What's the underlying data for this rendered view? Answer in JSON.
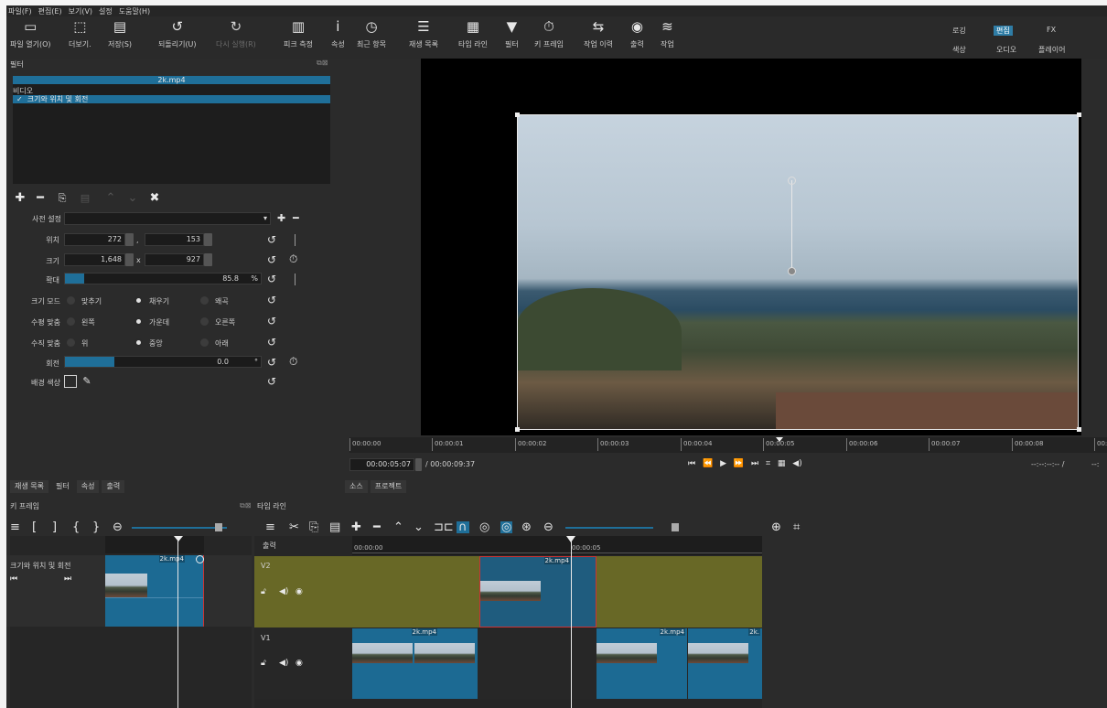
{
  "menu": [
    "파일(F)",
    "편집(E)",
    "보기(V)",
    "설정",
    "도움말(H)"
  ],
  "toolbar": {
    "open": "파일 열기(O)",
    "more": "더보기.",
    "save": "저장(S)",
    "undo": "되돌리기(U)",
    "redo": "다시 실행(R)",
    "peak": "피크 측정",
    "props": "속성",
    "recent": "최근 항목",
    "playlist": "재생 목록",
    "timeline": "타임 라인",
    "filters": "필터",
    "keyframes": "키 프레임",
    "history": "작업 이력",
    "export": "출력",
    "jobs": "작업"
  },
  "workspaces": {
    "logging": "로깅",
    "editing": "편집",
    "fx": "FX",
    "color": "색상",
    "audio": "오디오",
    "player": "플레이어"
  },
  "filter_panel": {
    "title": "필터",
    "clip_name": "2k.mp4",
    "section": "비디오",
    "filter_item": "크기와 위치 및 회전",
    "preset_label": "사전 설정",
    "position_label": "위치",
    "position_x": "272",
    "position_y": "153",
    "pos_sep": ",",
    "size_label": "크기",
    "size_w": "1,648",
    "size_h": "927",
    "size_sep": "x",
    "zoom_label": "확대",
    "zoom_value": "85.8",
    "zoom_unit": "%",
    "zoom_fraction": 0.1,
    "sizemode_label": "크기 모드",
    "sizemode_fit": "맞추기",
    "sizemode_fill": "채우기",
    "sizemode_distort": "왜곡",
    "halign_label": "수평 맞춤",
    "halign_left": "왼쪽",
    "halign_center": "가운데",
    "halign_right": "오른쪽",
    "valign_label": "수직 맞춤",
    "valign_top": "위",
    "valign_middle": "중앙",
    "valign_bottom": "아래",
    "rotation_label": "회전",
    "rotation_value": "0.0",
    "rotation_unit": "°",
    "rotation_fraction": 0.25,
    "bgcolor_label": "배경 색상"
  },
  "left_tabs": [
    "재생 목록",
    "필터",
    "속성",
    "출력"
  ],
  "player": {
    "ruler": [
      "00:00:00",
      "00:00:01",
      "00:00:02",
      "00:00:03",
      "00:00:04",
      "00:00:05",
      "00:00:06",
      "00:00:07",
      "00:00:08",
      "00:"
    ],
    "current_time": "00:00:05:07",
    "total_time": "/ 00:00:09:37",
    "in_out": "--:--:--:-- /",
    "in_out2": "--:",
    "tabs": [
      "소스",
      "프로젝트"
    ]
  },
  "keyframes_panel": {
    "title": "키 프레임",
    "track_label": "크기와 위치 및 회전",
    "clip_name": "2k.mp4"
  },
  "timeline": {
    "title": "타임 라인",
    "output_label": "출력",
    "ruler": [
      "00:00:00",
      "00:00:05"
    ],
    "tracks": [
      {
        "name": "V2",
        "clips": [
          "2k.mp4"
        ]
      },
      {
        "name": "V1",
        "clips": [
          "2k.mp4",
          "2k.mp4",
          "2k."
        ]
      }
    ]
  }
}
